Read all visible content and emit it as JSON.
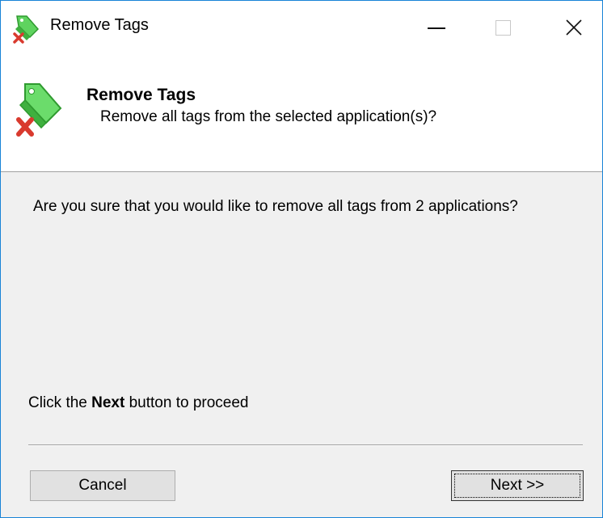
{
  "window": {
    "title": "Remove Tags"
  },
  "header": {
    "title": "Remove Tags",
    "subtitle": "Remove all tags from the selected application(s)?"
  },
  "body": {
    "question": "Are you sure that you would like to remove all tags from 2 applications?",
    "instruction_prefix": "Click the ",
    "instruction_bold": "Next",
    "instruction_suffix": " button to proceed"
  },
  "buttons": {
    "cancel_label": "Cancel",
    "next_label": "Next >>"
  },
  "icons": {
    "app_icon": "tag-remove-icon",
    "minimize": "minimize-icon",
    "maximize": "maximize-icon",
    "close": "close-icon"
  },
  "colors": {
    "window_border": "#1883d7",
    "tag_green": "#3fbf3f",
    "remove_red": "#d93a2e"
  }
}
